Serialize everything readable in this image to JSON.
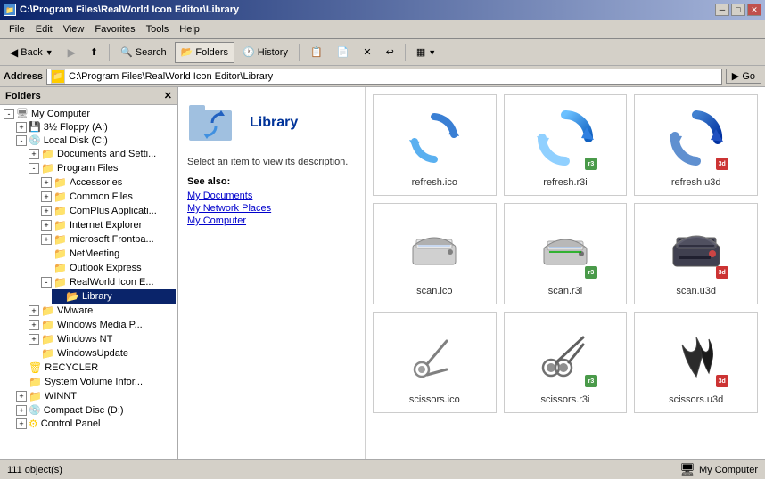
{
  "titleBar": {
    "title": "C:\\Program Files\\RealWorld Icon Editor\\Library",
    "icon": "📁",
    "minBtn": "─",
    "maxBtn": "□",
    "closeBtn": "✕"
  },
  "menuBar": {
    "items": [
      "File",
      "Edit",
      "View",
      "Favorites",
      "Tools",
      "Help"
    ]
  },
  "toolbar": {
    "backLabel": "Back",
    "forwardLabel": "→",
    "upLabel": "↑",
    "searchLabel": "Search",
    "foldersLabel": "Folders",
    "historyLabel": "History"
  },
  "addressBar": {
    "label": "Address",
    "value": "C:\\Program Files\\RealWorld Icon Editor\\Library",
    "goLabel": "Go"
  },
  "sidebar": {
    "title": "Folders",
    "tree": [
      {
        "label": "My Computer",
        "level": 0,
        "expanded": true,
        "hasExpand": true
      },
      {
        "label": "3½ Floppy (A:)",
        "level": 1,
        "expanded": false,
        "hasExpand": true
      },
      {
        "label": "Local Disk (C:)",
        "level": 1,
        "expanded": true,
        "hasExpand": true
      },
      {
        "label": "Documents and Setti...",
        "level": 2,
        "expanded": false,
        "hasExpand": true
      },
      {
        "label": "Program Files",
        "level": 2,
        "expanded": true,
        "hasExpand": true
      },
      {
        "label": "Accessories",
        "level": 3,
        "expanded": false,
        "hasExpand": true
      },
      {
        "label": "Common Files",
        "level": 3,
        "expanded": false,
        "hasExpand": true
      },
      {
        "label": "ComPlus Applicati...",
        "level": 3,
        "expanded": false,
        "hasExpand": true
      },
      {
        "label": "Internet Explorer",
        "level": 3,
        "expanded": false,
        "hasExpand": true
      },
      {
        "label": "microsoft Frontpa...",
        "level": 3,
        "expanded": false,
        "hasExpand": true
      },
      {
        "label": "NetMeeting",
        "level": 3,
        "expanded": false,
        "hasExpand": false
      },
      {
        "label": "Outlook Express",
        "level": 3,
        "expanded": false,
        "hasExpand": false
      },
      {
        "label": "RealWorld Icon E...",
        "level": 3,
        "expanded": true,
        "hasExpand": true
      },
      {
        "label": "Library",
        "level": 4,
        "expanded": false,
        "hasExpand": false,
        "selected": true
      },
      {
        "label": "VMware",
        "level": 2,
        "expanded": false,
        "hasExpand": true
      },
      {
        "label": "Windows Media P...",
        "level": 2,
        "expanded": false,
        "hasExpand": true
      },
      {
        "label": "Windows NT",
        "level": 2,
        "expanded": false,
        "hasExpand": true
      },
      {
        "label": "WindowsUpdate",
        "level": 2,
        "expanded": false,
        "hasExpand": false
      },
      {
        "label": "RECYCLER",
        "level": 1,
        "expanded": false,
        "hasExpand": false
      },
      {
        "label": "System Volume Infor...",
        "level": 1,
        "expanded": false,
        "hasExpand": false
      },
      {
        "label": "WINNT",
        "level": 1,
        "expanded": false,
        "hasExpand": true
      },
      {
        "label": "Compact Disc (D:)",
        "level": 1,
        "expanded": false,
        "hasExpand": true
      },
      {
        "label": "Control Panel",
        "level": 1,
        "expanded": false,
        "hasExpand": true
      }
    ]
  },
  "descPanel": {
    "title": "Library",
    "bodyText": "Select an item to view its description.",
    "seeAlso": "See also:",
    "links": [
      "My Documents",
      "My Network Places",
      "My Computer"
    ]
  },
  "filesGrid": {
    "items": [
      {
        "name": "refresh.ico",
        "type": "ico",
        "iconType": "refresh"
      },
      {
        "name": "refresh.r3i",
        "type": "r3i",
        "iconType": "refresh"
      },
      {
        "name": "refresh.u3d",
        "type": "u3d",
        "iconType": "refresh"
      },
      {
        "name": "scan.ico",
        "type": "ico",
        "iconType": "scan"
      },
      {
        "name": "scan.r3i",
        "type": "r3i",
        "iconType": "scan"
      },
      {
        "name": "scan.u3d",
        "type": "u3d",
        "iconType": "scan"
      },
      {
        "name": "scissors.ico",
        "type": "ico",
        "iconType": "scissors"
      },
      {
        "name": "scissors.r3i",
        "type": "r3i",
        "iconType": "scissors"
      },
      {
        "name": "scissors.u3d",
        "type": "u3d",
        "iconType": "scissors"
      }
    ]
  },
  "statusBar": {
    "itemCount": "111 object(s)",
    "computerLabel": "My Computer"
  }
}
